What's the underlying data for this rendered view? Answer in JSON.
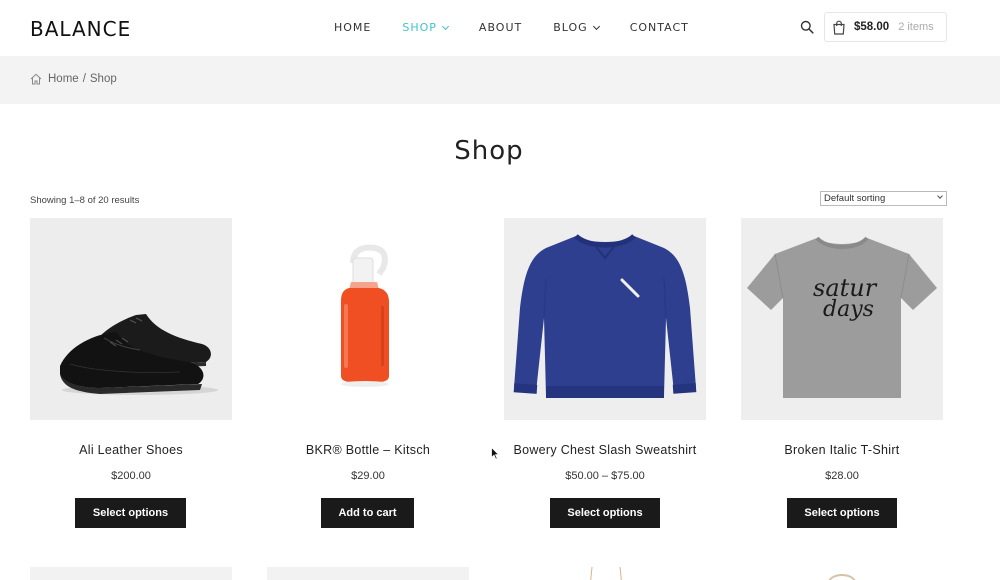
{
  "header": {
    "logo": "BALANCE",
    "nav": [
      {
        "label": "HOME",
        "active": false,
        "dropdown": false
      },
      {
        "label": "SHOP",
        "active": true,
        "dropdown": true
      },
      {
        "label": "ABOUT",
        "active": false,
        "dropdown": false
      },
      {
        "label": "BLOG",
        "active": false,
        "dropdown": true
      },
      {
        "label": "CONTACT",
        "active": false,
        "dropdown": false
      }
    ],
    "search_icon": "search-icon",
    "cart": {
      "icon": "shopping-bag-icon",
      "total": "$58.00",
      "count": "2 items"
    }
  },
  "breadcrumb": {
    "icon": "home-icon",
    "home": "Home",
    "separator": "/",
    "current": "Shop"
  },
  "page": {
    "title": "Shop",
    "result_count": "Showing 1–8 of 20 results",
    "sorting": "Default sorting"
  },
  "products": [
    {
      "title": "Ali Leather Shoes",
      "price": "$200.00",
      "button": "Select options",
      "image": "black-leather-shoes"
    },
    {
      "title": "BKR® Bottle – Kitsch",
      "price": "$29.00",
      "button": "Add to cart",
      "image": "orange-glass-bottle"
    },
    {
      "title": "Bowery Chest Slash Sweatshirt",
      "price": "$50.00 – $75.00",
      "button": "Select options",
      "image": "blue-sweatshirt"
    },
    {
      "title": "Broken Italic T-Shirt",
      "price": "$28.00",
      "button": "Select options",
      "image": "grey-t-shirt"
    }
  ],
  "colors": {
    "accent": "#3ec3c8",
    "button_bg": "#1a1a1a",
    "breadcrumb_bg": "#f3f3f3"
  }
}
